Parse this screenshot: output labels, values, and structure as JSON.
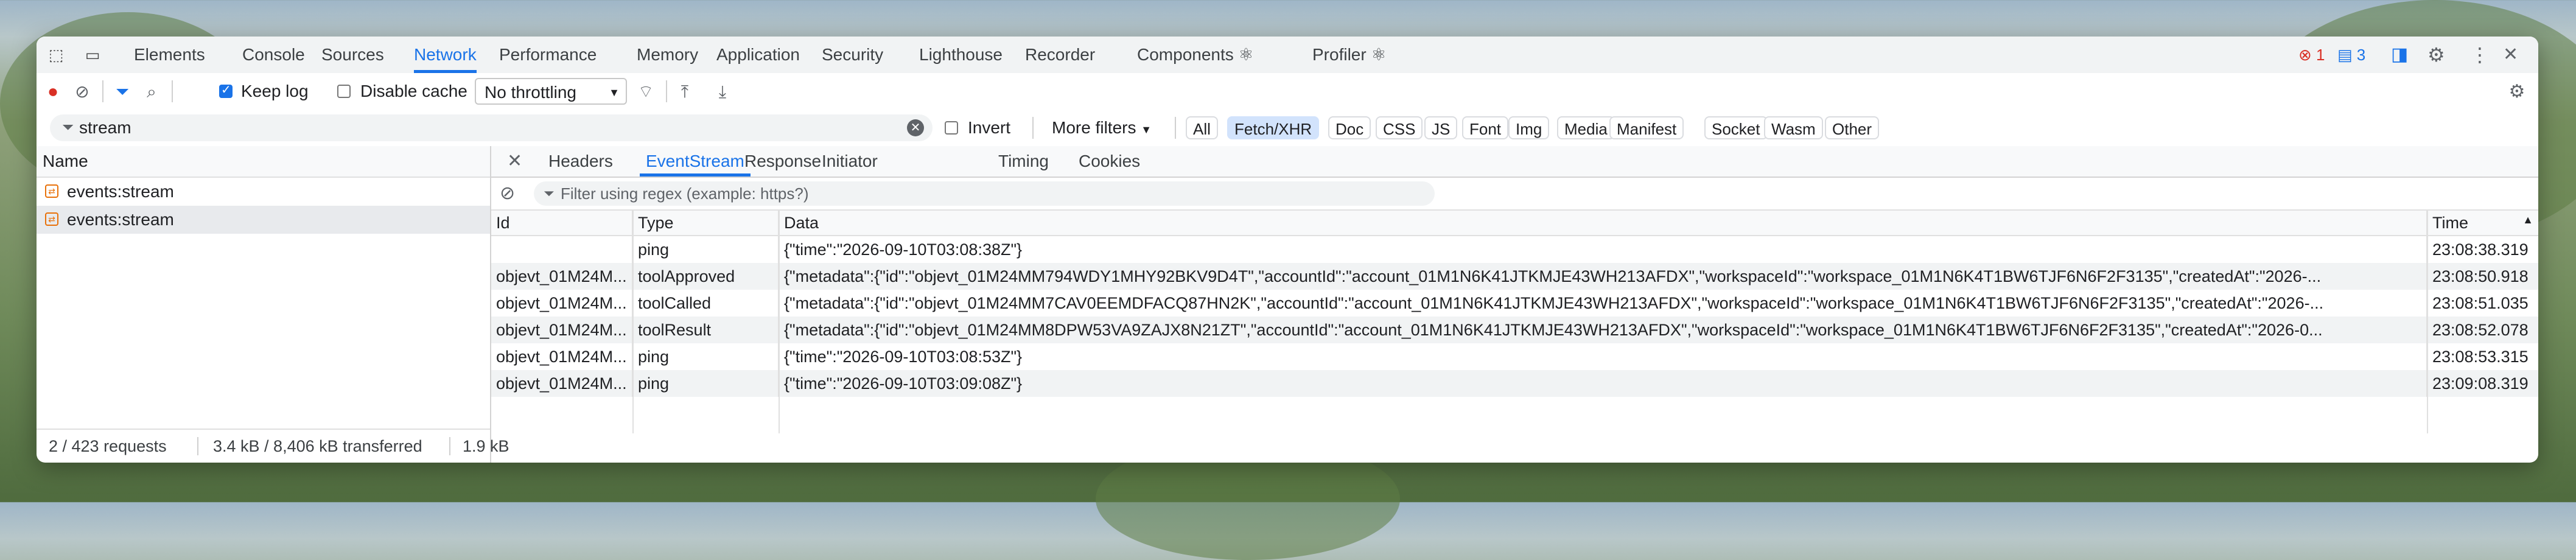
{
  "tabs": [
    "Elements",
    "Console",
    "Sources",
    "Network",
    "Performance",
    "Memory",
    "Application",
    "Security",
    "Lighthouse",
    "Recorder",
    "Components ⚛",
    "Profiler ⚛"
  ],
  "active_tab": "Network",
  "errors": "1",
  "messages": "3",
  "toolbar": {
    "keep_log": "Keep log",
    "disable_cache": "Disable cache",
    "throttling": "No throttling"
  },
  "filter": {
    "value": "stream",
    "invert": "Invert",
    "more_filters": "More filters"
  },
  "type_filters": [
    "All",
    "Fetch/XHR",
    "Doc",
    "CSS",
    "JS",
    "Font",
    "Img",
    "Media",
    "Manifest",
    "Socket",
    "Wasm",
    "Other"
  ],
  "active_type": "Fetch/XHR",
  "requests": {
    "header": "Name",
    "items": [
      "events:stream",
      "events:stream"
    ]
  },
  "footer": {
    "requests": "2 / 423 requests",
    "transferred": "3.4 kB / 8,406 kB transferred",
    "size": "1.9 kB"
  },
  "detail_tabs": [
    "Headers",
    "EventStream",
    "Response",
    "Initiator",
    "Timing",
    "Cookies"
  ],
  "active_detail_tab": "EventStream",
  "event_filter_placeholder": "Filter using regex (example: https?)",
  "columns": {
    "id": "Id",
    "type": "Type",
    "data": "Data",
    "time": "Time"
  },
  "events": [
    {
      "id": "",
      "type": "ping",
      "data": "{\"time\":\"2026-09-10T03:08:38Z\"}",
      "time": "23:08:38.319"
    },
    {
      "id": "objevt_01M24M...",
      "type": "toolApproved",
      "data": "{\"metadata\":{\"id\":\"objevt_01M24MM794WDY1MHY92BKV9D4T\",\"accountId\":\"account_01M1N6K41JTKMJE43WH213AFDX\",\"workspaceId\":\"workspace_01M1N6K4T1BW6TJF6N6F2F3135\",\"createdAt\":\"2026-...",
      "time": "23:08:50.918"
    },
    {
      "id": "objevt_01M24M...",
      "type": "toolCalled",
      "data": "{\"metadata\":{\"id\":\"objevt_01M24MM7CAV0EEMDFACQ87HN2K\",\"accountId\":\"account_01M1N6K41JTKMJE43WH213AFDX\",\"workspaceId\":\"workspace_01M1N6K4T1BW6TJF6N6F2F3135\",\"createdAt\":\"2026-...",
      "time": "23:08:51.035"
    },
    {
      "id": "objevt_01M24M...",
      "type": "toolResult",
      "data": "{\"metadata\":{\"id\":\"objevt_01M24MM8DPW53VA9ZAJX8N21ZT\",\"accountId\":\"account_01M1N6K41JTKMJE43WH213AFDX\",\"workspaceId\":\"workspace_01M1N6K4T1BW6TJF6N6F2F3135\",\"createdAt\":\"2026-0...",
      "time": "23:08:52.078"
    },
    {
      "id": "objevt_01M24M...",
      "type": "ping",
      "data": "{\"time\":\"2026-09-10T03:08:53Z\"}",
      "time": "23:08:53.315"
    },
    {
      "id": "objevt_01M24M...",
      "type": "ping",
      "data": "{\"time\":\"2026-09-10T03:09:08Z\"}",
      "time": "23:09:08.319"
    }
  ]
}
